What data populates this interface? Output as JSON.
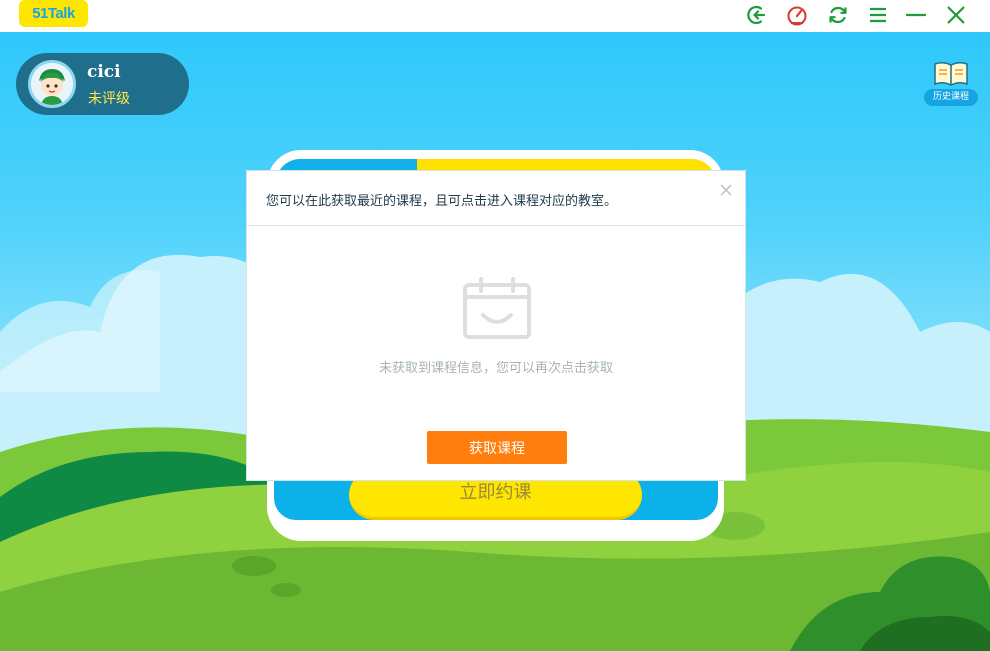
{
  "titlebar": {
    "logo_text": "51Talk",
    "buttons": [
      {
        "icon": "exit-icon",
        "color": "#1e9b3a"
      },
      {
        "icon": "speedometer-icon",
        "color": "#d9382b"
      },
      {
        "icon": "refresh-icon",
        "color": "#1e9b3a"
      },
      {
        "icon": "menu-icon",
        "color": "#1e9b3a"
      },
      {
        "icon": "minimize-icon",
        "color": "#1e9b3a"
      },
      {
        "icon": "close-icon",
        "color": "#1e9b3a"
      }
    ]
  },
  "profile": {
    "username": "cici",
    "level": "未评级"
  },
  "history": {
    "label": "历史课程"
  },
  "card": {
    "book_button": "立即约课"
  },
  "dialog": {
    "title": "您可以在此获取最近的课程，且可点击进入课程对应的教室。",
    "empty_message": "未获取到课程信息，您可以再次点击获取",
    "fetch_button": "获取课程"
  },
  "colors": {
    "accent_orange": "#ff7e0e",
    "brand_yellow": "#ffe600",
    "sky_blue": "#2ec8fb",
    "grass_green": "#7ac43a"
  }
}
